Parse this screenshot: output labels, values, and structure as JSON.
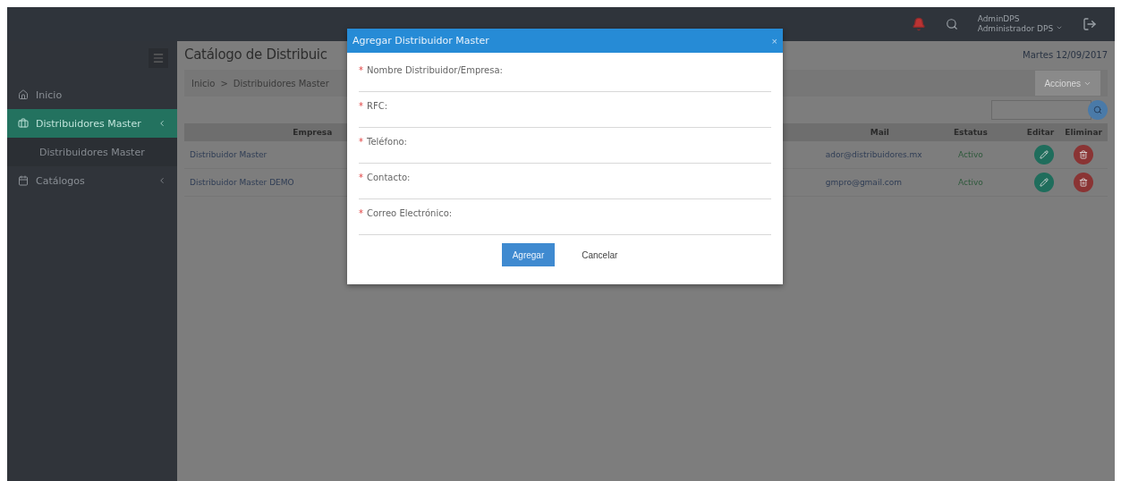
{
  "topbar": {
    "user_name": "AdminDPS",
    "user_role": "Administrador DPS",
    "notifications": true
  },
  "sidebar": {
    "items": [
      {
        "label": "Inicio",
        "selected": false
      },
      {
        "label": "Distribuidores Master",
        "selected": true,
        "children": [
          {
            "label": "Distribuidores Master",
            "selected": false
          }
        ]
      },
      {
        "label": "Catálogos",
        "selected": false
      }
    ]
  },
  "page": {
    "title": "Catálogo de Distribuic",
    "date": "Martes 12/09/2017",
    "breadcrumb": [
      "Inicio",
      "Distribuidores Master"
    ],
    "breadcrumb_separator": ">",
    "actions_button": "Acciones"
  },
  "table": {
    "columns": [
      "Empresa",
      "Mail",
      "Estatus",
      "Editar",
      "Eliminar"
    ],
    "rows": [
      {
        "empresa": "Distribuidor Master",
        "mail": "ador@distribuidores.mx",
        "estatus": "Activo"
      },
      {
        "empresa": "Distribuidor Master DEMO",
        "mail": "gmpro@gmail.com",
        "estatus": "Activo"
      }
    ]
  },
  "modal": {
    "title": "Agregar Distribuidor Master",
    "close": "×",
    "required_mark": "*",
    "fields": [
      {
        "label": "Nombre Distribuidor/Empresa:",
        "required": true
      },
      {
        "label": "RFC:",
        "required": true
      },
      {
        "label": "Teléfono:",
        "required": true
      },
      {
        "label": "Contacto:",
        "required": true
      },
      {
        "label": "Correo Electrónico:",
        "required": true
      }
    ],
    "buttons": [
      {
        "label": "Agregar",
        "kind": "primary"
      },
      {
        "label": "Cancelar",
        "kind": "link"
      }
    ]
  }
}
